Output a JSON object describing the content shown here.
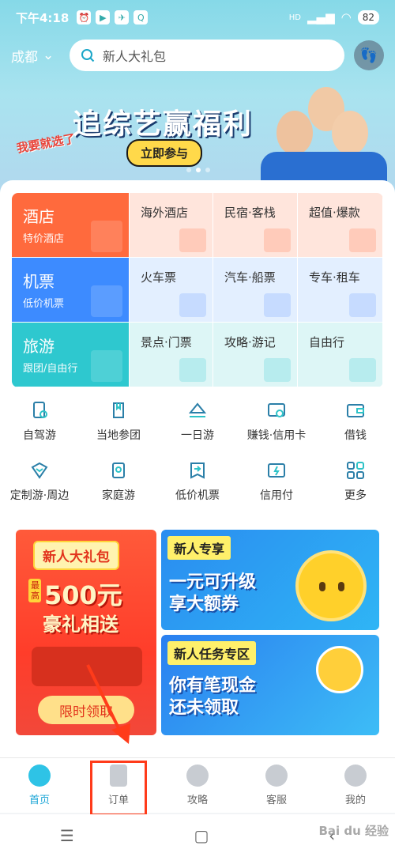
{
  "status": {
    "time": "下午4:18",
    "battery": "82",
    "network": "HD"
  },
  "search": {
    "city": "成都",
    "placeholder": "新人大礼包"
  },
  "banner": {
    "title": "追综艺赢福利",
    "cta": "立即参与",
    "logo": "我要就选了"
  },
  "grid": [
    {
      "main": "酒店",
      "sub": "特价酒店",
      "items": [
        "海外酒店",
        "民宿·客栈",
        "超值·爆款"
      ]
    },
    {
      "main": "机票",
      "sub": "低价机票",
      "items": [
        "火车票",
        "汽车·船票",
        "专车·租车"
      ]
    },
    {
      "main": "旅游",
      "sub": "跟团/自由行",
      "items": [
        "景点·门票",
        "攻略·游记",
        "自由行"
      ]
    }
  ],
  "icons_row1": [
    "自驾游",
    "当地参团",
    "一日游",
    "赚钱·信用卡",
    "借钱"
  ],
  "icons_row2": [
    "定制游·周边",
    "家庭游",
    "低价机票",
    "信用付",
    "更多"
  ],
  "promo_left": {
    "tag": "新人大礼包",
    "most": "最高",
    "amount": "500元",
    "sub": "豪礼相送",
    "button": "限时领取"
  },
  "promo_right_top": {
    "tag": "新人专享",
    "line1": "一元可升级",
    "line2": "享大额券"
  },
  "promo_right_bottom": {
    "tag": "新人任务专区",
    "line1": "你有笔现金",
    "line2": "还未领取"
  },
  "tabs": [
    "首页",
    "订单",
    "攻略",
    "客服",
    "我的"
  ],
  "watermark": "Bai du 经验",
  "colors": {
    "accent": "#19a5d6",
    "hotel": "#ff6a3d",
    "flight": "#3d8bff",
    "travel": "#2ec8cf",
    "highlight": "#ff3b1a"
  }
}
